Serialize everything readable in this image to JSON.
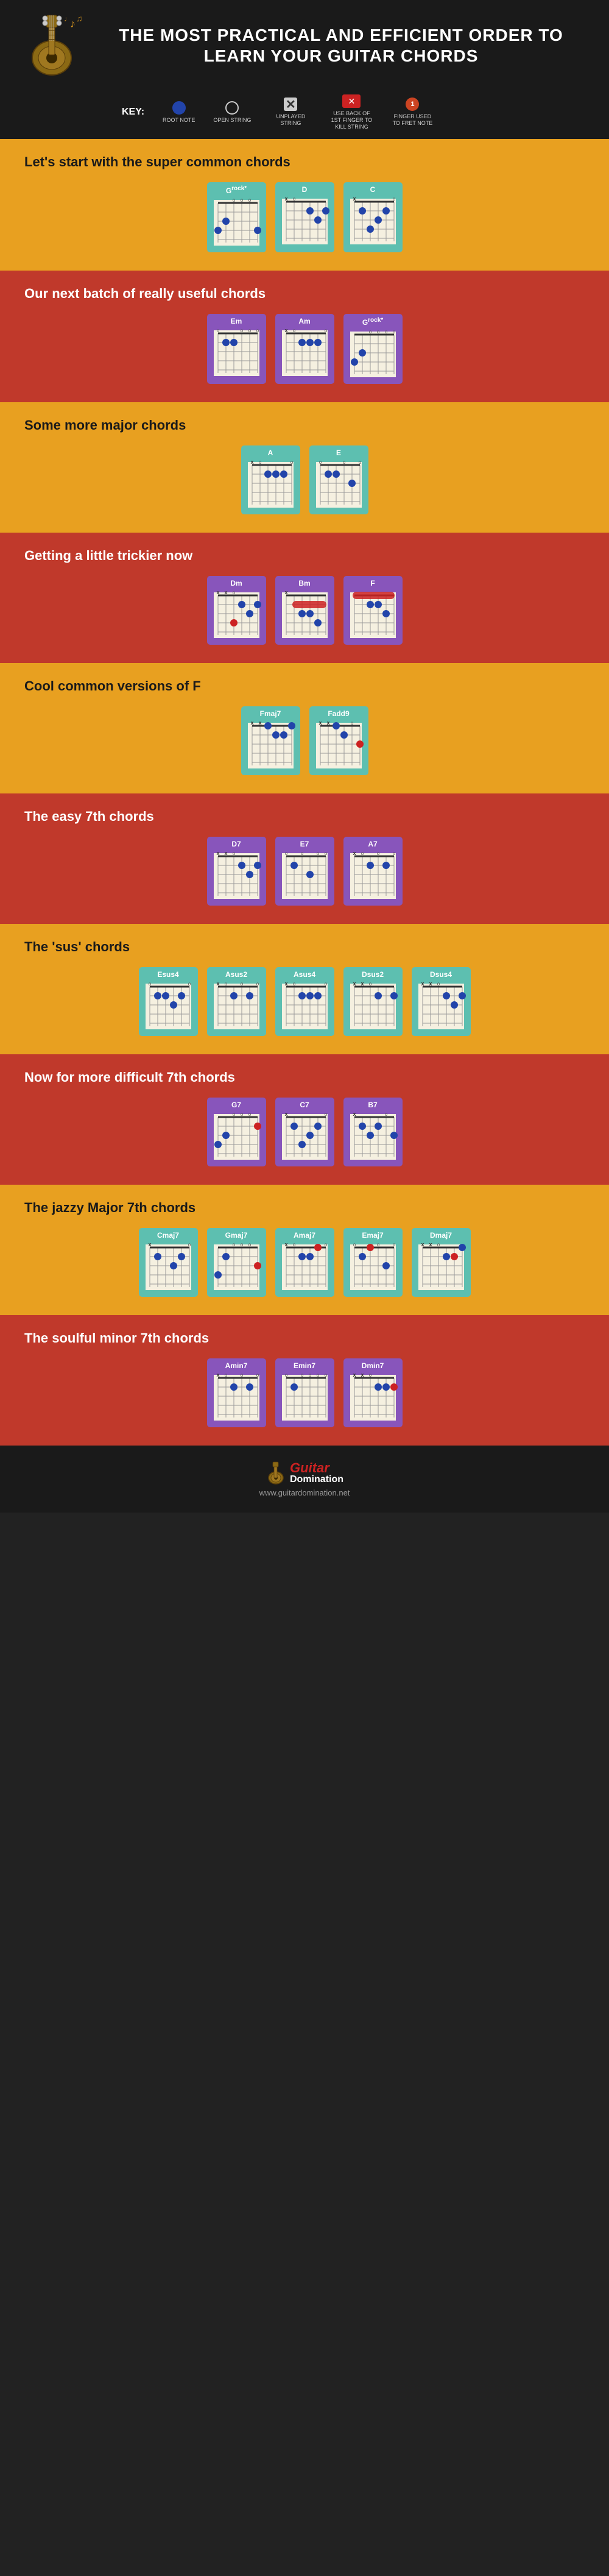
{
  "header": {
    "title": "THE MOST PRACTICAL AND EFFICIENT ORDER TO LEARN YOUR GUITAR CHORDS",
    "key_label": "KEY:",
    "key_items": [
      {
        "label": "ROOT NOTE",
        "type": "filled_circle"
      },
      {
        "label": "OPEN STRING",
        "type": "open_circle"
      },
      {
        "label": "UNPLAYED STRING",
        "type": "x"
      },
      {
        "label": "USE BACK OF 1ST FINGER TO KILL STRING",
        "type": "kill"
      },
      {
        "label": "FINGER USED TO FRET NOTE",
        "type": "fret"
      }
    ]
  },
  "sections": [
    {
      "id": "super-common",
      "bg": "yellow",
      "title": "Let's start with the super common chords",
      "chords": [
        "G",
        "D",
        "C"
      ]
    },
    {
      "id": "really-useful",
      "bg": "red",
      "title": "Our next batch of really useful chords",
      "chords": [
        "Em",
        "Am",
        "G"
      ]
    },
    {
      "id": "more-major",
      "bg": "yellow",
      "title": "Some more major chords",
      "chords": [
        "A",
        "E"
      ]
    },
    {
      "id": "trickier",
      "bg": "red",
      "title": "Getting a little trickier now",
      "chords": [
        "Dm",
        "Bm",
        "F"
      ]
    },
    {
      "id": "cool-f",
      "bg": "yellow",
      "title": "Cool common versions of F",
      "chords": [
        "Fmaj7",
        "Fadd9"
      ]
    },
    {
      "id": "easy-7th",
      "bg": "red",
      "title": "The easy 7th chords",
      "chords": [
        "D7",
        "E7",
        "A7"
      ]
    },
    {
      "id": "sus-chords",
      "bg": "yellow",
      "title": "The 'sus' chords",
      "chords": [
        "Esus4",
        "Asus2",
        "Asus4",
        "Dsus2",
        "Dsus4"
      ]
    },
    {
      "id": "difficult-7th",
      "bg": "red",
      "title": "Now for more difficult 7th chords",
      "chords": [
        "G7",
        "C7",
        "B7"
      ]
    },
    {
      "id": "jazzy-maj7",
      "bg": "yellow",
      "title": "The jazzy Major 7th chords",
      "chords": [
        "Cmaj7",
        "Gmaj7",
        "Amaj7",
        "Emaj7",
        "Dmaj7"
      ]
    },
    {
      "id": "soulful-min7",
      "bg": "red",
      "title": "The soulful minor 7th chords",
      "chords": [
        "Amin7",
        "Emin7",
        "Dmin7"
      ]
    }
  ],
  "footer": {
    "logo_italic": "Guitar",
    "logo_text": "Domination",
    "url": "www.guitardomination.net"
  }
}
